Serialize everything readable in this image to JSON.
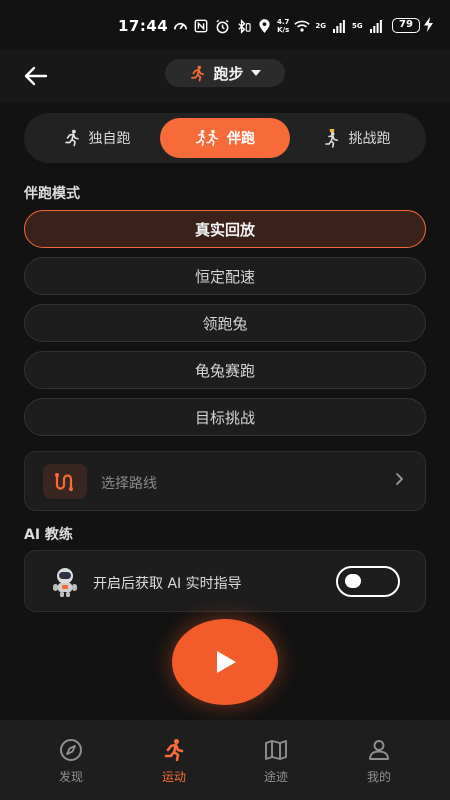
{
  "status_bar": {
    "time": "17:44",
    "speed_value": "4.7",
    "speed_unit": "K/s",
    "net_1": "2G",
    "net_2": "5G",
    "battery": "79"
  },
  "header": {
    "back_icon": "arrow-left-icon",
    "sport": "跑步",
    "sport_icon": "runner-icon",
    "dropdown_icon": "caret-down-icon"
  },
  "mode_tabs": [
    {
      "label": "独自跑",
      "icon": "runner-icon",
      "active": false
    },
    {
      "label": "伴跑",
      "icon": "two-runners-icon",
      "active": true
    },
    {
      "label": "挑战跑",
      "icon": "trophy-runner-icon",
      "active": false
    }
  ],
  "companion": {
    "title": "伴跑模式",
    "options": [
      "真实回放",
      "恒定配速",
      "领跑兔",
      "龟兔赛跑",
      "目标挑战"
    ],
    "selected_index": 0
  },
  "route": {
    "label": "选择路线",
    "icon": "route-icon"
  },
  "ai_coach": {
    "title": "AI 教练",
    "label": "开启后获取 AI 实时指导",
    "avatar_icon": "astronaut-icon",
    "enabled": false
  },
  "start_button": {
    "icon": "play-icon"
  },
  "bottom_nav": [
    {
      "label": "发现",
      "icon": "compass-icon",
      "active": false
    },
    {
      "label": "运动",
      "icon": "runner-icon",
      "active": true
    },
    {
      "label": "途迹",
      "icon": "map-icon",
      "active": false
    },
    {
      "label": "我的",
      "icon": "user-icon",
      "active": false
    }
  ],
  "colors": {
    "accent": "#f76b3b",
    "background": "#121212",
    "card": "#1d1d1d"
  }
}
